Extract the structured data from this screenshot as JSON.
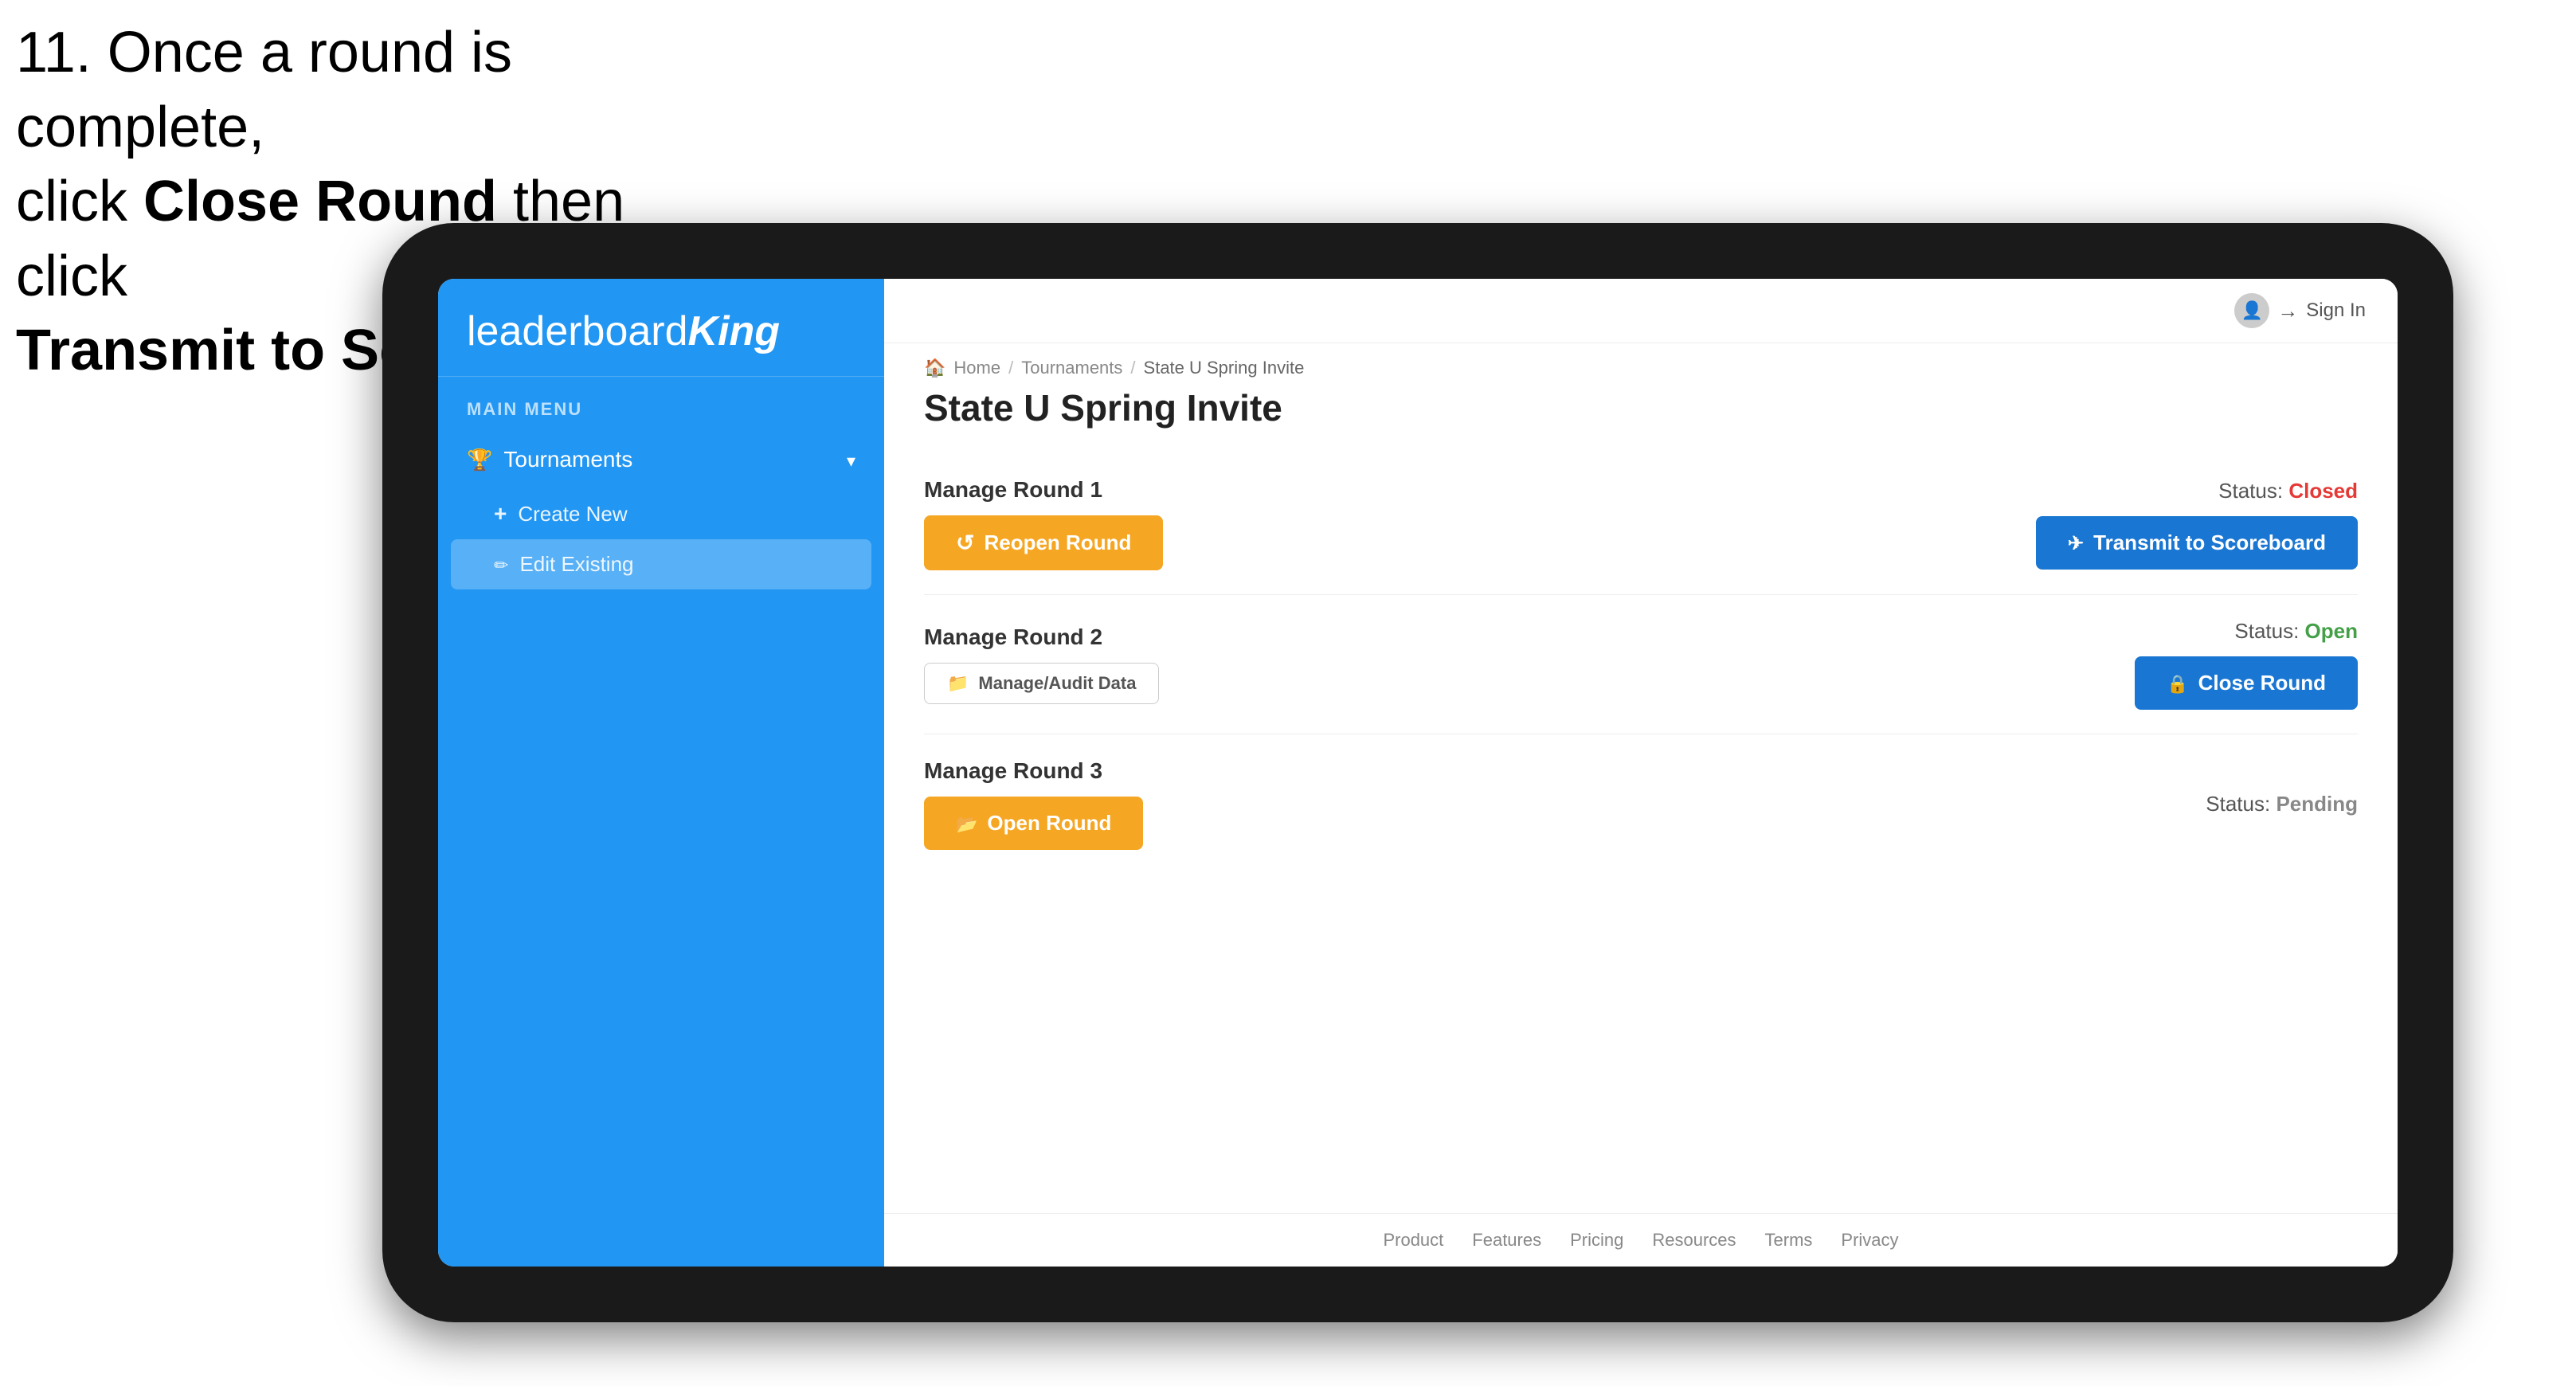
{
  "instruction": {
    "line1": "11. Once a round is complete,",
    "line2_pre": "click ",
    "line2_bold": "Close Round",
    "line2_post": " then click",
    "line3": "Transmit to Scoreboard."
  },
  "sidebar": {
    "logo_leaderboard": "leaderboard",
    "logo_king": "King",
    "menu_label": "MAIN MENU",
    "tournaments_label": "Tournaments",
    "create_new_label": "Create New",
    "edit_existing_label": "Edit Existing"
  },
  "topbar": {
    "sign_in_label": "Sign In"
  },
  "breadcrumb": {
    "home": "Home",
    "sep1": "/",
    "tournaments": "Tournaments",
    "sep2": "/",
    "current": "State U Spring Invite"
  },
  "page": {
    "title": "State U Spring Invite",
    "round1": {
      "title": "Manage Round 1",
      "status_label": "Status:",
      "status_value": "Closed",
      "reopen_btn": "Reopen Round",
      "transmit_btn": "Transmit to Scoreboard"
    },
    "round2": {
      "title": "Manage Round 2",
      "status_label": "Status:",
      "status_value": "Open",
      "audit_btn": "Manage/Audit Data",
      "close_btn": "Close Round"
    },
    "round3": {
      "title": "Manage Round 3",
      "status_label": "Status:",
      "status_value": "Pending",
      "open_btn": "Open Round"
    }
  },
  "footer": {
    "links": [
      "Product",
      "Features",
      "Pricing",
      "Resources",
      "Terms",
      "Privacy"
    ]
  },
  "arrow": {
    "color": "#e53935"
  }
}
